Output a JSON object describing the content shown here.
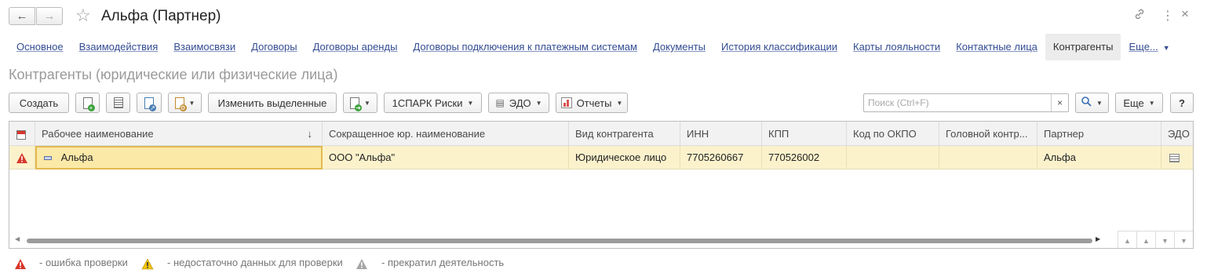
{
  "window": {
    "title": "Альфа (Партнер)",
    "nav_back_icon": "arrow-left-icon",
    "nav_forward_icon": "arrow-right-icon",
    "favorite_icon": "star-icon",
    "link_icon": "link-icon",
    "more_icon": "kebab-icon",
    "close_icon": "close-icon"
  },
  "tabs": [
    {
      "label": "Основное"
    },
    {
      "label": "Взаимодействия"
    },
    {
      "label": "Взаимосвязи"
    },
    {
      "label": "Договоры"
    },
    {
      "label": "Договоры аренды"
    },
    {
      "label": "Договоры подключения к платежным системам"
    },
    {
      "label": "Документы"
    },
    {
      "label": "История классификации"
    },
    {
      "label": "Карты лояльности"
    },
    {
      "label": "Контактные лица"
    },
    {
      "label": "Контрагенты",
      "active": true
    },
    {
      "label": "Еще..."
    }
  ],
  "page": {
    "subtitle": "Контрагенты (юридические или физические лица)"
  },
  "toolbar": {
    "create_label": "Создать",
    "change_selected_label": "Изменить выделенные",
    "spark_label": "1СПАРК Риски",
    "edo_label": "ЭДО",
    "reports_label": "Отчеты",
    "more_label": "Еще",
    "help_label": "?",
    "search_placeholder": "Поиск (Ctrl+F)",
    "clear_label": "×"
  },
  "table": {
    "columns": [
      "Рабочее наименование",
      "Сокращенное юр. наименование",
      "Вид контрагента",
      "ИНН",
      "КПП",
      "Код по ОКПО",
      "Головной контр...",
      "Партнер",
      "ЭДО"
    ],
    "sort_indicator": "↓",
    "rows": [
      {
        "status": "error",
        "name": "Альфа",
        "short_name": "ООО \"Альфа\"",
        "kind": "Юридическое лицо",
        "inn": "7705260667",
        "kpp": "770526002",
        "okpo": "",
        "head": "",
        "partner": "Альфа",
        "edo": "edo-icon"
      }
    ]
  },
  "legend": {
    "error": "- ошибка проверки",
    "insufficient": "- недостаточно данных для проверки",
    "stopped": "- прекратил деятельность"
  },
  "colors": {
    "link": "#334c92",
    "row_highlight": "#fbf2cc",
    "error": "#d9372b",
    "warning": "#f1c40f",
    "stopped": "#9a9a9a"
  }
}
